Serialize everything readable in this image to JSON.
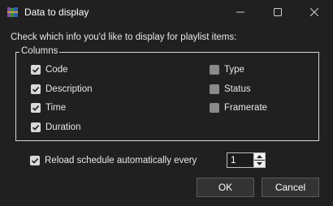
{
  "window": {
    "title": "Data to display",
    "app_icon": "rar-books-icon",
    "controls": {
      "minimize": "minimize-icon",
      "maximize": "maximize-icon",
      "close": "close-icon"
    }
  },
  "dialog": {
    "instruction": "Check which info you'd like to display for playlist items:",
    "group_label": "Columns",
    "columns": [
      {
        "label": "Code",
        "checked": true
      },
      {
        "label": "Description",
        "checked": true
      },
      {
        "label": "Time",
        "checked": true
      },
      {
        "label": "Duration",
        "checked": true
      },
      {
        "label": "Type",
        "checked": false
      },
      {
        "label": "Status",
        "checked": false
      },
      {
        "label": "Framerate",
        "checked": false
      }
    ],
    "reload": {
      "label": "Reload schedule automatically every",
      "checked": true,
      "value": "1"
    },
    "ok_label": "OK",
    "cancel_label": "Cancel"
  },
  "colors": {
    "background": "#202020",
    "text": "#e8e8e8",
    "checkbox_on": "#d9d9d9",
    "checkbox_off": "#8a8a8a",
    "button_bg": "#333333"
  }
}
